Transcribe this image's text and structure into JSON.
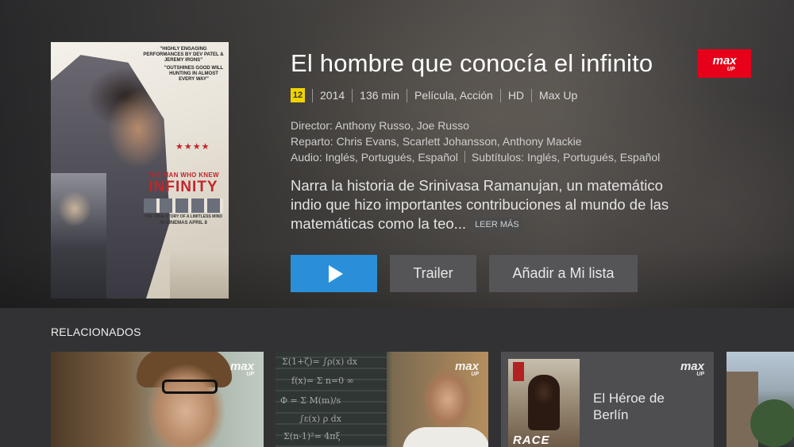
{
  "movie": {
    "title": "El hombre que conocía el infinito",
    "rating": "12",
    "year": "2014",
    "duration": "136 min",
    "genre": "Película, Acción",
    "quality": "HD",
    "provider": "Max Up",
    "director": "Director: Anthony Russo, Joe Russo",
    "cast": "Reparto: Chris Evans, Scarlett Johansson, Anthony Mackie",
    "audio": "Audio: Inglés, Portugués, Español",
    "subtitles": "Subtítulos: Inglés, Portugués, Español",
    "synopsis": "Narra la historia de Srinivasa Ramanujan, un matemático indio que hizo importantes contribuciones al mundo de las matemáticas como la teo...",
    "read_more": "LEER MÁS"
  },
  "brand": {
    "logo_text": "max",
    "logo_sub": "UP",
    "color": "#e60019"
  },
  "poster": {
    "quote1": "\"HIGHLY ENGAGING PERFORMANCES BY DEV PATEL & JEREMY IRONS\"",
    "quote2": "\"OUTSHINES GOOD WILL HUNTING IN ALMOST EVERY WAY\"",
    "stars": "★★★★",
    "title_top": "THE MAN WHO KNEW",
    "title_main": "INFINITY",
    "tagline": "THE TRUE STORY OF A LIMITLESS MIND",
    "release": "IN CINEMAS APRIL 8"
  },
  "buttons": {
    "play_icon": "play-icon",
    "trailer": "Trailer",
    "add_list": "Añadir a Mi lista",
    "play_color": "#2a8fd8"
  },
  "related": {
    "heading": "RELACIONADOS",
    "items": [
      {
        "title": "",
        "logo": "max",
        "logo_sub": "UP"
      },
      {
        "title": "",
        "logo": "max",
        "logo_sub": "UP",
        "board_text": [
          "Σ(1+ζ)= ∫ρ(x) dx",
          "f(x)= Σ n=0 ∞",
          "Φ = Σ M(m)/s",
          "∫ε(x) ρ dx",
          "Σ(n-1)²= 4πξ"
        ]
      },
      {
        "title": "El Héroe de Berlín",
        "logo": "max",
        "logo_sub": "UP",
        "poster_text": "RACE"
      },
      {
        "title": ""
      }
    ]
  }
}
